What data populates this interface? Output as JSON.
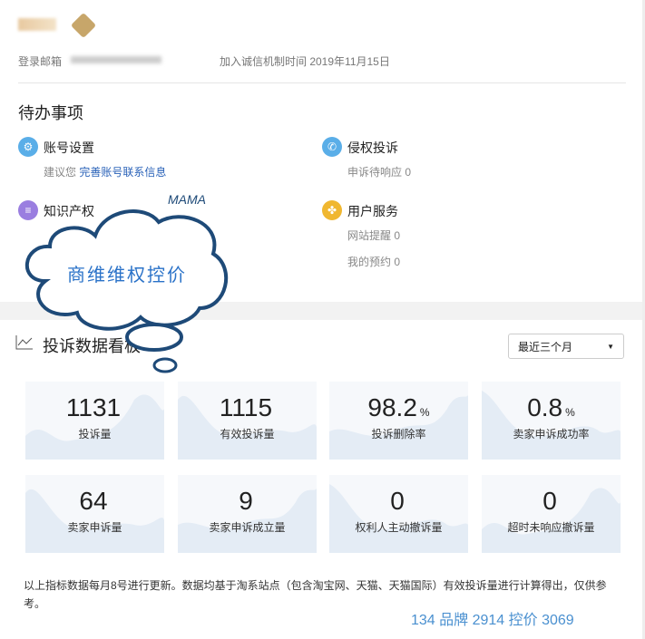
{
  "header": {
    "email_label": "登录邮箱",
    "join_label": "加入诚信机制时间 2019年11月15日"
  },
  "todo": {
    "title": "待办事项",
    "items": [
      {
        "title": "账号设置",
        "sub_prefix": "建议您 ",
        "sub_link": "完善账号联系信息",
        "color": "#5aaee8"
      },
      {
        "title": "侵权投诉",
        "sub": "申诉待响应 0",
        "color": "#5aaee8"
      },
      {
        "title": "知识产权",
        "color": "#9a7ee0"
      },
      {
        "title": "用户服务",
        "sub": "网站提醒 0",
        "sub2": "我的预约 0",
        "color": "#f0b730"
      }
    ]
  },
  "dashboard": {
    "title": "投诉数据看板",
    "range": "最近三个月",
    "cards": [
      {
        "value": "1131",
        "unit": "",
        "label": "投诉量"
      },
      {
        "value": "1115",
        "unit": "",
        "label": "有效投诉量"
      },
      {
        "value": "98.2",
        "unit": "%",
        "label": "投诉删除率"
      },
      {
        "value": "0.8",
        "unit": "%",
        "label": "卖家申诉成功率"
      },
      {
        "value": "64",
        "unit": "",
        "label": "卖家申诉量"
      },
      {
        "value": "9",
        "unit": "",
        "label": "卖家申诉成立量"
      },
      {
        "value": "0",
        "unit": "",
        "label": "权利人主动撤诉量"
      },
      {
        "value": "0",
        "unit": "",
        "label": "超时未响应撤诉量"
      }
    ]
  },
  "note": "以上指标数据每月8号进行更新。数据均基于淘系站点（包含淘宝网、天猫、天猫国际）有效投诉量进行计算得出，仅供参考。",
  "watermark": {
    "cloud": "商维维权控价",
    "mama": "MAMA"
  },
  "stats": "134 品牌 2914 控价 3069"
}
